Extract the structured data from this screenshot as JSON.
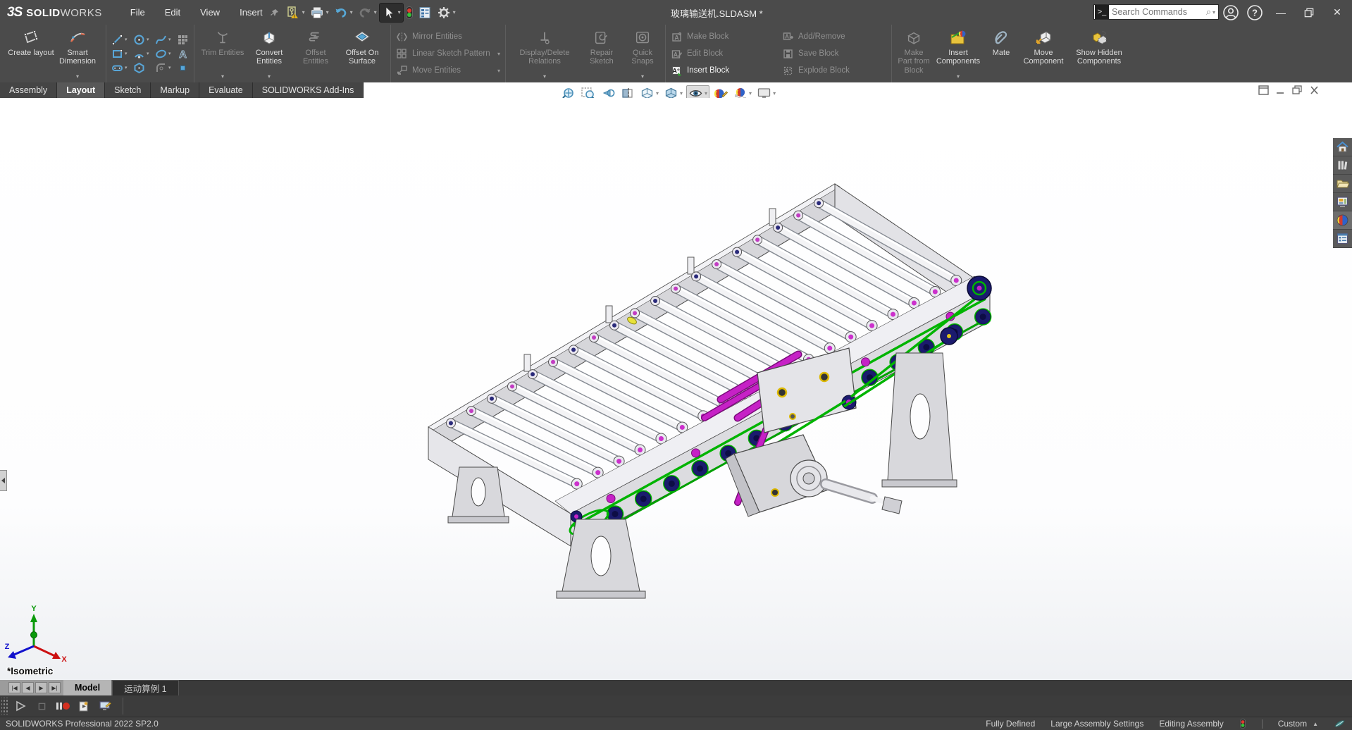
{
  "titlebar": {
    "logo_3s": "3S",
    "logo_solid": "SOLID",
    "logo_works": "WORKS",
    "menu_file": "File",
    "menu_edit": "Edit",
    "menu_view": "View",
    "menu_insert": "Insert",
    "title": "玻璃输送机.SLDASM *",
    "search_placeholder": "Search Commands"
  },
  "titlebar_icons": [
    "certificate-key-icon",
    "print-icon",
    "undo-icon",
    "redo-icon",
    "select-cursor-icon",
    "rebuild-traffic-light-icon",
    "file-properties-icon",
    "options-gear-icon",
    "user-account-icon",
    "help-icon",
    "minimize-icon",
    "restore-icon",
    "close-icon"
  ],
  "ribbon": {
    "create_layout": "Create layout",
    "smart_dimension": "Smart Dimension",
    "trim": "Trim Entities",
    "convert": "Convert Entities",
    "offset": "Offset Entities",
    "offset_on_surface": "Offset On Surface",
    "mirror": "Mirror Entities",
    "linear_pattern": "Linear Sketch Pattern",
    "move_entities": "Move Entities",
    "display_delete": "Display/Delete Relations",
    "repair_sketch": "Repair Sketch",
    "quick_snaps": "Quick Snaps",
    "make_block": "Make Block",
    "edit_block": "Edit Block",
    "insert_block": "Insert Block",
    "add_remove": "Add/Remove",
    "save_block": "Save Block",
    "explode_block": "Explode Block",
    "make_part_from_block": "Make Part from Block",
    "insert_components": "Insert Components",
    "mate": "Mate",
    "move_component": "Move Component",
    "show_hidden_components": "Show Hidden Components"
  },
  "sketch_tool_icons": [
    "line-tool-icon",
    "circle-tool-icon",
    "spline-tool-icon",
    "sketch-pattern-icon",
    "rectangle-tool-icon",
    "arc-tool-icon",
    "ellipse-tool-icon",
    "text-tool-icon",
    "slot-tool-icon",
    "polygon-tool-icon",
    "fillet-tool-icon",
    "point-tool-icon"
  ],
  "command_tabs": {
    "assembly": "Assembly",
    "layout": "Layout",
    "sketch": "Sketch",
    "markup": "Markup",
    "evaluate": "Evaluate",
    "addins": "SOLIDWORKS Add-Ins"
  },
  "headsup_icons": [
    "zoom-to-fit-icon",
    "zoom-to-area-icon",
    "previous-view-icon",
    "section-view-icon",
    "view-orientation-icon",
    "display-style-icon",
    "hide-show-items-icon",
    "edit-appearance-icon",
    "apply-scene-icon",
    "view-settings-icon"
  ],
  "taskpane_icons": [
    "home-icon",
    "design-library-icon",
    "file-explorer-icon",
    "view-palette-icon",
    "appearances-scenes-icon",
    "custom-properties-icon"
  ],
  "viewport": {
    "orientation_label": "*Isometric",
    "triad": {
      "x": "X",
      "y": "Y",
      "z": "Z"
    }
  },
  "motion": {
    "model_tab": "Model",
    "study_tab": "运动算例 1",
    "icons": [
      "play-icon",
      "stop-icon",
      "record-icon",
      "animation-wizard-icon",
      "save-animation-icon"
    ]
  },
  "statusbar": {
    "app_version": "SOLIDWORKS Professional 2022 SP2.0",
    "fully_defined": "Fully Defined",
    "large_assembly": "Large Assembly Settings",
    "editing": "Editing Assembly",
    "config": "Custom"
  },
  "colors": {
    "chrome": "#4b4b4b",
    "accent_blue": "#4e9fd4",
    "chain_green": "#00b400",
    "shaft_magenta": "#c621c6",
    "sprocket_navy": "#1b1b6e",
    "viewport_bg": "#ffffff"
  }
}
